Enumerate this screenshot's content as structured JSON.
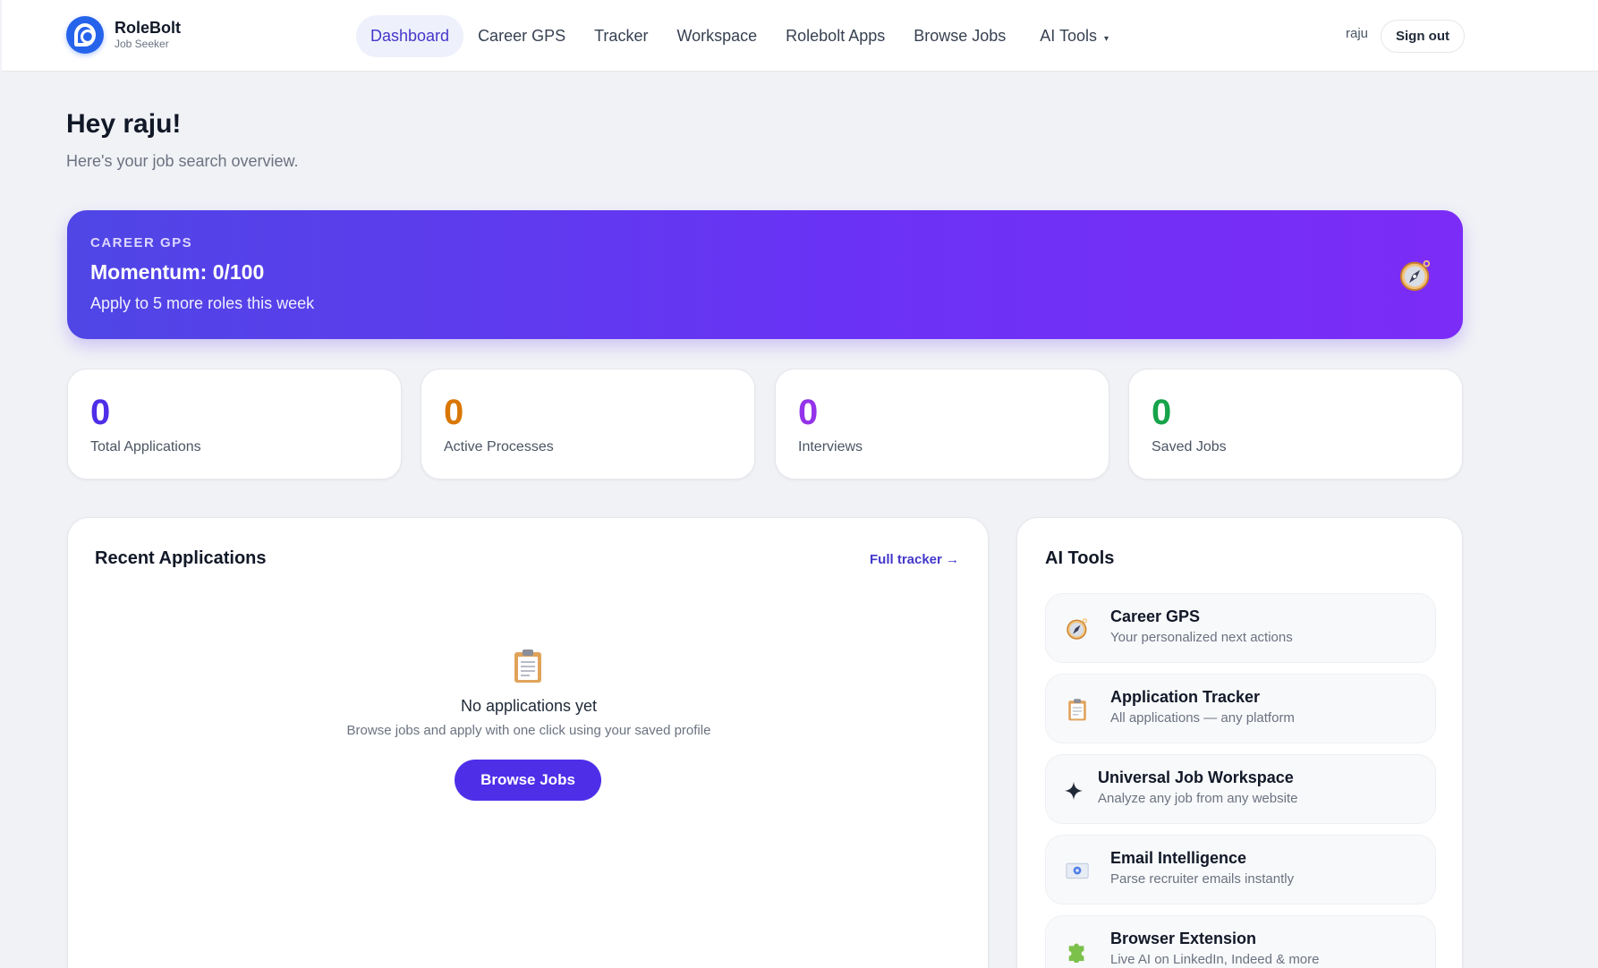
{
  "brand": {
    "name": "RoleBolt",
    "subtitle": "Job Seeker"
  },
  "nav": {
    "items": [
      {
        "label": "Dashboard",
        "active": true
      },
      {
        "label": "Career GPS",
        "active": false
      },
      {
        "label": "Tracker",
        "active": false
      },
      {
        "label": "Workspace",
        "active": false
      },
      {
        "label": "Rolebolt Apps",
        "active": false
      },
      {
        "label": "Browse Jobs",
        "active": false
      },
      {
        "label": "AI Tools",
        "active": false,
        "dropdown": true
      }
    ],
    "dropdown_caret": "▾"
  },
  "user": {
    "name": "raju",
    "signout_label": "Sign out"
  },
  "greeting": {
    "title": "Hey raju!",
    "subtitle": "Here's your job search overview."
  },
  "hero": {
    "eyebrow": "CAREER GPS",
    "title": "Momentum: 0/100",
    "subtitle": "Apply to 5 more roles this week",
    "icon": "compass-icon"
  },
  "stats": [
    {
      "value": "0",
      "label": "Total Applications",
      "color": "#4f2ee8"
    },
    {
      "value": "0",
      "label": "Active Processes",
      "color": "#d97706"
    },
    {
      "value": "0",
      "label": "Interviews",
      "color": "#9333ea"
    },
    {
      "value": "0",
      "label": "Saved Jobs",
      "color": "#16a34a"
    }
  ],
  "recent": {
    "title": "Recent Applications",
    "link_label": "Full tracker →",
    "empty_icon": "clipboard-icon",
    "empty_title": "No applications yet",
    "empty_subtitle": "Browse jobs and apply with one click using your saved profile",
    "button_label": "Browse Jobs"
  },
  "ai_tools": {
    "title": "AI Tools",
    "items": [
      {
        "title": "Career GPS",
        "subtitle": "Your personalized next actions",
        "icon": "compass-icon"
      },
      {
        "title": "Application Tracker",
        "subtitle": "All applications — any platform",
        "icon": "clipboard-icon"
      },
      {
        "title": "Universal Job Workspace",
        "subtitle": "Analyze any job from any website",
        "icon": "sparkle-icon"
      },
      {
        "title": "Email Intelligence",
        "subtitle": "Parse recruiter emails instantly",
        "icon": "email-icon"
      },
      {
        "title": "Browser Extension",
        "subtitle": "Live AI on LinkedIn, Indeed & more",
        "icon": "puzzle-icon"
      }
    ]
  }
}
